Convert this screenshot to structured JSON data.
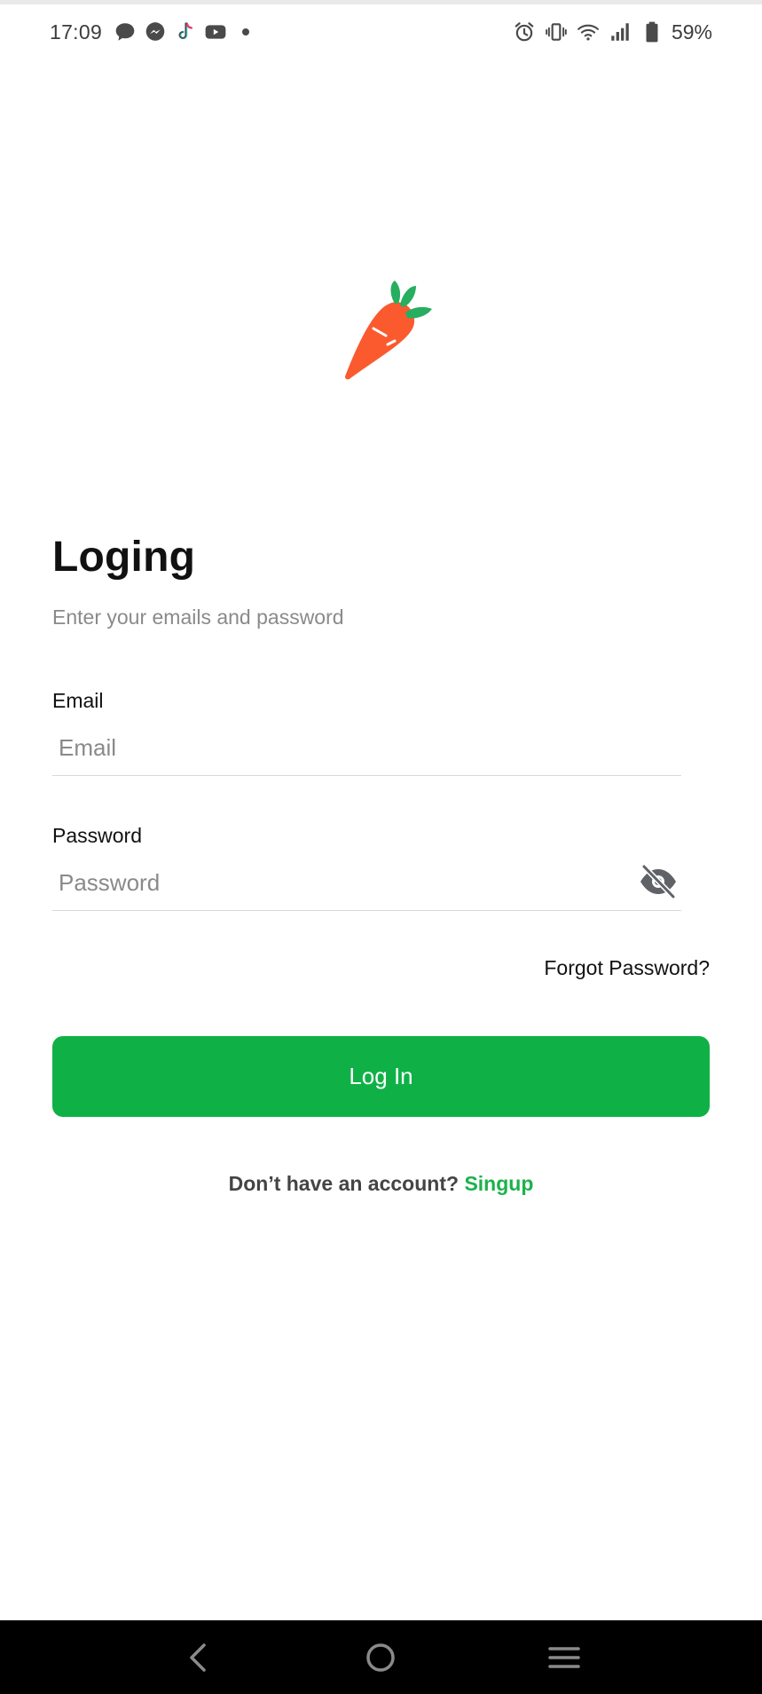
{
  "status_bar": {
    "time": "17:09",
    "battery": "59%",
    "left_icons": [
      "chat-icon",
      "messenger-icon",
      "tiktok-icon",
      "youtube-icon",
      "dot-icon"
    ],
    "right_icons": [
      "alarm-icon",
      "vibrate-icon",
      "wifi-icon",
      "signal-icon",
      "battery-icon"
    ]
  },
  "logo": {
    "icon": "carrot-icon",
    "color_body": "#fb5a2f",
    "color_leaves": "#27ae60"
  },
  "login": {
    "title": "Loging",
    "subtitle": "Enter your emails and password",
    "email_label": "Email",
    "email_placeholder": "Email",
    "email_value": "",
    "password_label": "Password",
    "password_placeholder": "Password",
    "password_value": "",
    "forgot_label": "Forgot Password?",
    "button_label": "Log In",
    "signup_prompt": "Don’t have an account?",
    "signup_link": "Singup"
  },
  "colors": {
    "accent": "#0fb146",
    "link": "#1bb24b"
  },
  "nav_bar": {
    "icons": [
      "back-icon",
      "home-icon",
      "recents-icon"
    ]
  }
}
